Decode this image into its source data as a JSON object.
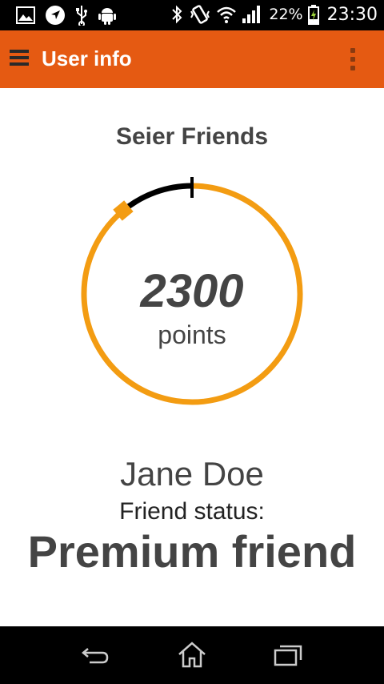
{
  "status_bar": {
    "battery_percent": "22%",
    "time": "23:30",
    "icons": [
      "image-icon",
      "navigation-icon",
      "usb-icon",
      "android-icon",
      "bluetooth-icon",
      "vibrate-icon",
      "wifi-icon",
      "signal-icon",
      "battery-charging-icon"
    ]
  },
  "app_bar": {
    "title": "User info",
    "menu_icon": "hamburger-menu-icon",
    "overflow_icon": "more-vert-icon"
  },
  "profile": {
    "club_name": "Seier Friends",
    "points": "2300",
    "points_label": "points",
    "progress_fraction": 0.89,
    "name": "Jane Doe",
    "status_label": "Friend status:",
    "status_value": "Premium friend"
  },
  "nav_bar": {
    "icons": [
      "back-icon",
      "home-icon",
      "recent-apps-icon"
    ]
  },
  "colors": {
    "accent": "#e55a12",
    "progress": "#f39c12",
    "remaining": "#000000",
    "text": "#444444"
  }
}
